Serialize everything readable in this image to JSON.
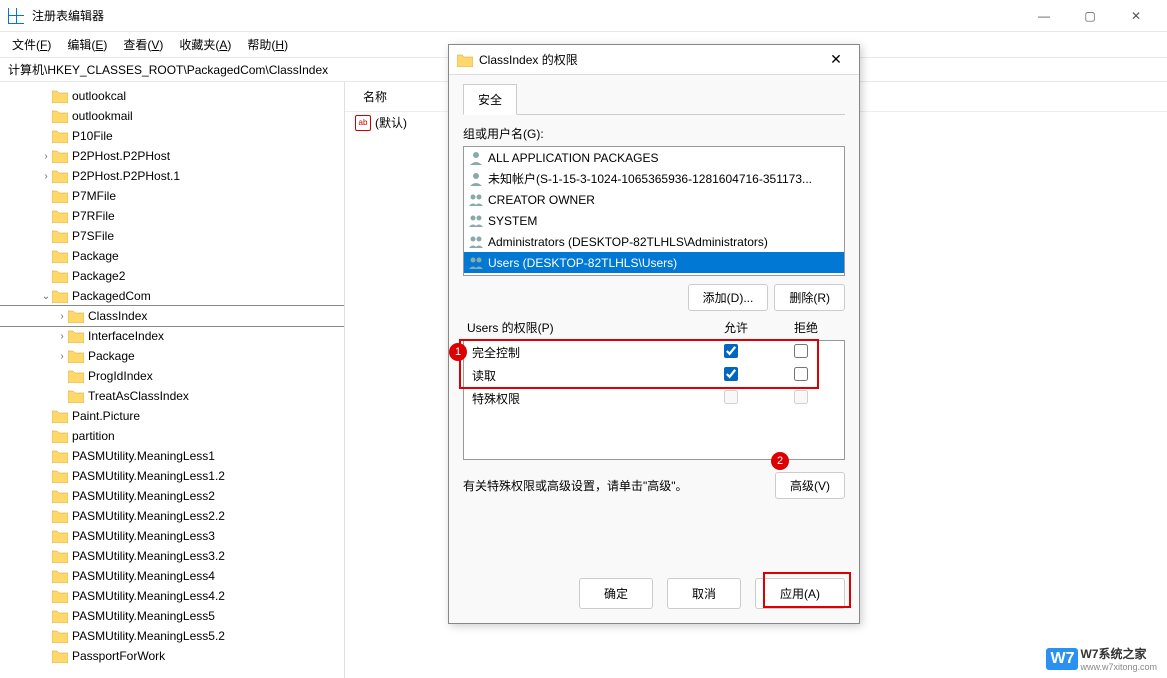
{
  "window": {
    "title": "注册表编辑器",
    "controls": {
      "min": "—",
      "max": "▢",
      "close": "✕"
    }
  },
  "menu": [
    {
      "label": "文件",
      "u": "F"
    },
    {
      "label": "编辑",
      "u": "E"
    },
    {
      "label": "查看",
      "u": "V"
    },
    {
      "label": "收藏夹",
      "u": "A"
    },
    {
      "label": "帮助",
      "u": "H"
    }
  ],
  "address": "计算机\\HKEY_CLASSES_ROOT\\PackagedCom\\ClassIndex",
  "tree": [
    {
      "indent": 2,
      "exp": "",
      "label": "outlookcal"
    },
    {
      "indent": 2,
      "exp": "",
      "label": "outlookmail"
    },
    {
      "indent": 2,
      "exp": "",
      "label": "P10File"
    },
    {
      "indent": 2,
      "exp": ">",
      "label": "P2PHost.P2PHost"
    },
    {
      "indent": 2,
      "exp": ">",
      "label": "P2PHost.P2PHost.1"
    },
    {
      "indent": 2,
      "exp": "",
      "label": "P7MFile"
    },
    {
      "indent": 2,
      "exp": "",
      "label": "P7RFile"
    },
    {
      "indent": 2,
      "exp": "",
      "label": "P7SFile"
    },
    {
      "indent": 2,
      "exp": "",
      "label": "Package"
    },
    {
      "indent": 2,
      "exp": "",
      "label": "Package2"
    },
    {
      "indent": 2,
      "exp": "v",
      "label": "PackagedCom"
    },
    {
      "indent": 3,
      "exp": ">",
      "label": "ClassIndex",
      "sel": true
    },
    {
      "indent": 3,
      "exp": ">",
      "label": "InterfaceIndex"
    },
    {
      "indent": 3,
      "exp": ">",
      "label": "Package"
    },
    {
      "indent": 3,
      "exp": "",
      "label": "ProgIdIndex"
    },
    {
      "indent": 3,
      "exp": "",
      "label": "TreatAsClassIndex"
    },
    {
      "indent": 2,
      "exp": "",
      "label": "Paint.Picture"
    },
    {
      "indent": 2,
      "exp": "",
      "label": "partition"
    },
    {
      "indent": 2,
      "exp": "",
      "label": "PASMUtility.MeaningLess1"
    },
    {
      "indent": 2,
      "exp": "",
      "label": "PASMUtility.MeaningLess1.2"
    },
    {
      "indent": 2,
      "exp": "",
      "label": "PASMUtility.MeaningLess2"
    },
    {
      "indent": 2,
      "exp": "",
      "label": "PASMUtility.MeaningLess2.2"
    },
    {
      "indent": 2,
      "exp": "",
      "label": "PASMUtility.MeaningLess3"
    },
    {
      "indent": 2,
      "exp": "",
      "label": "PASMUtility.MeaningLess3.2"
    },
    {
      "indent": 2,
      "exp": "",
      "label": "PASMUtility.MeaningLess4"
    },
    {
      "indent": 2,
      "exp": "",
      "label": "PASMUtility.MeaningLess4.2"
    },
    {
      "indent": 2,
      "exp": "",
      "label": "PASMUtility.MeaningLess5"
    },
    {
      "indent": 2,
      "exp": "",
      "label": "PASMUtility.MeaningLess5.2"
    },
    {
      "indent": 2,
      "exp": "",
      "label": "PassportForWork"
    }
  ],
  "value_header": {
    "name_col": "名称"
  },
  "value_row": {
    "name": "(默认)"
  },
  "dialog": {
    "title": "ClassIndex 的权限",
    "tab": "安全",
    "group_label": "组或用户名(G):",
    "groups": [
      {
        "label": "ALL APPLICATION PACKAGES",
        "icon": "person"
      },
      {
        "label": "未知帐户(S-1-15-3-1024-1065365936-1281604716-351173...",
        "icon": "person"
      },
      {
        "label": "CREATOR OWNER",
        "icon": "people"
      },
      {
        "label": "SYSTEM",
        "icon": "people"
      },
      {
        "label": "Administrators (DESKTOP-82TLHLS\\Administrators)",
        "icon": "people"
      },
      {
        "label": "Users (DESKTOP-82TLHLS\\Users)",
        "icon": "people",
        "sel": true
      }
    ],
    "add_btn": "添加(D)...",
    "remove_btn": "删除(R)",
    "perm_label": "Users 的权限(P)",
    "allow_col": "允许",
    "deny_col": "拒绝",
    "perms": [
      {
        "name": "完全控制",
        "allow": true,
        "deny": false
      },
      {
        "name": "读取",
        "allow": true,
        "deny": false
      },
      {
        "name": "特殊权限",
        "allow": false,
        "deny": false,
        "disabled": true
      }
    ],
    "advanced_hint": "有关特殊权限或高级设置，请单击\"高级\"。",
    "advanced_btn": "高级(V)",
    "ok_btn": "确定",
    "cancel_btn": "取消",
    "apply_btn": "应用(A)"
  },
  "badges": {
    "one": "1",
    "two": "2"
  },
  "watermark": {
    "brand": "W7系统之家",
    "url": "www.w7xitong.com",
    "logo": "W7"
  }
}
